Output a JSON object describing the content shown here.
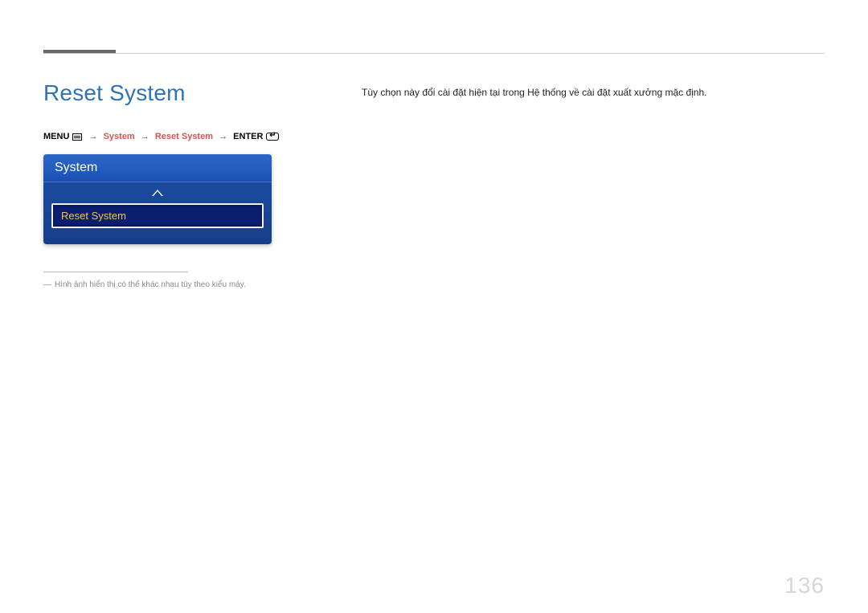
{
  "heading": "Reset System",
  "breadcrumb": {
    "menu": "MENU",
    "system": "System",
    "reset": "Reset System",
    "enter": "ENTER"
  },
  "osd": {
    "title": "System",
    "selected_item": "Reset System"
  },
  "footnote": "Hình ảnh hiển thị có thể khác nhau tùy theo kiểu máy.",
  "description": "Tùy chọn này đổi cài đặt hiện tại trong Hệ thống về cài đặt xuất xưởng mặc định.",
  "page_number": "136"
}
